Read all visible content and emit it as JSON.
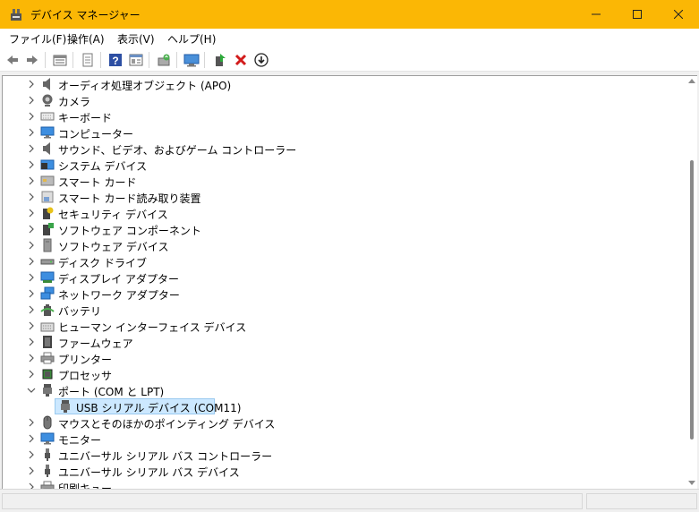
{
  "window": {
    "title": "デバイス マネージャー",
    "accent_color": "#fbb705",
    "controls": [
      "minimize-icon",
      "maximize-icon",
      "close-icon"
    ]
  },
  "menu": {
    "items": [
      "ファイル(F)",
      "操作(A)",
      "表示(V)",
      "ヘルプ(H)"
    ]
  },
  "toolbar": {
    "buttons": [
      "back-arrow-icon",
      "forward-arrow-icon",
      "properties-list-icon",
      "document-icon",
      "help-icon",
      "view-icon",
      "update-driver-icon",
      "scan-hardware-icon",
      "enable-device-icon",
      "uninstall-device-icon",
      "download-driver-icon"
    ]
  },
  "tree": {
    "items": [
      {
        "label": "オーディオ処理オブジェクト (APO)",
        "icon": "speaker-icon",
        "expanded": false
      },
      {
        "label": "カメラ",
        "icon": "camera-icon",
        "expanded": false
      },
      {
        "label": "キーボード",
        "icon": "keyboard-icon",
        "expanded": false
      },
      {
        "label": "コンピューター",
        "icon": "computer-icon",
        "expanded": false
      },
      {
        "label": "サウンド、ビデオ、およびゲーム コントローラー",
        "icon": "speaker-icon",
        "expanded": false
      },
      {
        "label": "システム デバイス",
        "icon": "system-device-icon",
        "expanded": false
      },
      {
        "label": "スマート カード",
        "icon": "smart-card-icon",
        "expanded": false
      },
      {
        "label": "スマート カード読み取り装置",
        "icon": "card-reader-icon",
        "expanded": false
      },
      {
        "label": "セキュリティ デバイス",
        "icon": "security-device-icon",
        "expanded": false
      },
      {
        "label": "ソフトウェア コンポーネント",
        "icon": "software-component-icon",
        "expanded": false
      },
      {
        "label": "ソフトウェア デバイス",
        "icon": "software-device-icon",
        "expanded": false
      },
      {
        "label": "ディスク ドライブ",
        "icon": "disk-drive-icon",
        "expanded": false
      },
      {
        "label": "ディスプレイ アダプター",
        "icon": "display-adapter-icon",
        "expanded": false
      },
      {
        "label": "ネットワーク アダプター",
        "icon": "network-adapter-icon",
        "expanded": false
      },
      {
        "label": "バッテリ",
        "icon": "battery-icon",
        "expanded": false
      },
      {
        "label": "ヒューマン インターフェイス デバイス",
        "icon": "hid-icon",
        "expanded": false
      },
      {
        "label": "ファームウェア",
        "icon": "firmware-icon",
        "expanded": false
      },
      {
        "label": "プリンター",
        "icon": "printer-icon",
        "expanded": false
      },
      {
        "label": "プロセッサ",
        "icon": "processor-icon",
        "expanded": false
      },
      {
        "label": "ポート (COM と LPT)",
        "icon": "port-icon",
        "expanded": true
      },
      {
        "label": "USB シリアル デバイス (COM11)",
        "icon": "port-icon",
        "child": true,
        "selected": true
      },
      {
        "label": "マウスとそのほかのポインティング デバイス",
        "icon": "mouse-icon",
        "expanded": false
      },
      {
        "label": "モニター",
        "icon": "monitor-icon",
        "expanded": false
      },
      {
        "label": "ユニバーサル シリアル バス コントローラー",
        "icon": "usb-icon",
        "expanded": false
      },
      {
        "label": "ユニバーサル シリアル バス デバイス",
        "icon": "usb-icon",
        "expanded": false
      },
      {
        "label": "印刷キュー",
        "icon": "printer-icon",
        "expanded": false
      }
    ]
  }
}
